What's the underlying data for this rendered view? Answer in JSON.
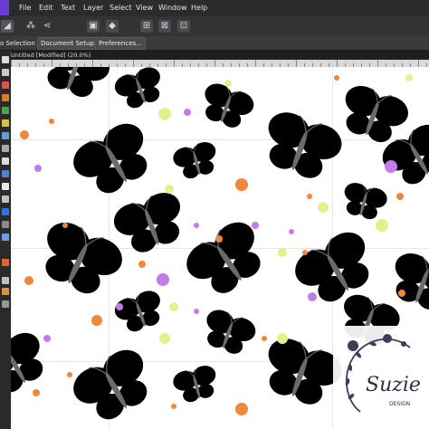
{
  "menubar": {
    "items": [
      "File",
      "Edit",
      "Text",
      "Layer",
      "Select",
      "View",
      "Window",
      "Help"
    ]
  },
  "context_toolbar": {
    "selection_label": "o Selection",
    "document_setup": "Document Setup...",
    "preferences": "Preferences..."
  },
  "document": {
    "tab_title": "Untitled [Modified] (20.0%)"
  },
  "colors": {
    "purple": "#a24ad2",
    "purple_light": "#c37be8",
    "orange": "#f0873a",
    "orange_light": "#f6b37a",
    "lime": "#d8f35b",
    "lime_light": "#ecfb9a",
    "body": "#6b6b6b"
  },
  "watermark": {
    "brand": "Suzie",
    "subtitle": "DESIGN"
  }
}
